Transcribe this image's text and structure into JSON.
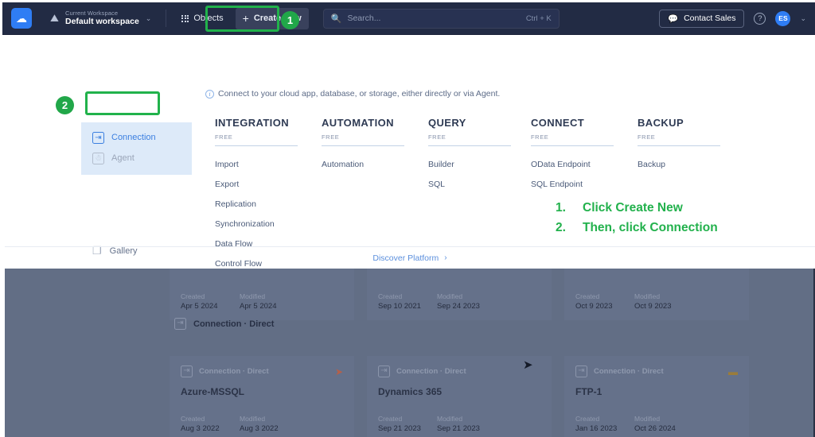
{
  "topnav": {
    "logo_icon": "cloud-icon",
    "workspace": {
      "eyebrow": "Current Workspace",
      "name": "Default workspace",
      "caret": "⌄",
      "icon": "workspace-icon"
    },
    "objects_label": "Objects",
    "create_new_label": "Create New",
    "create_new_plus": "+",
    "search": {
      "value": "",
      "placeholder": "Search...",
      "shortcut": "Ctrl + K",
      "icon": "search-icon"
    },
    "contact_sales_label": "Contact Sales",
    "contact_icon": "chat-icon",
    "help_icon": "?",
    "avatar_initials": "ES",
    "avatar_caret": "⌄"
  },
  "callouts": {
    "badge_one": "1",
    "badge_two": "2",
    "accent_green": "#21b24b",
    "tips": [
      {
        "num": "1.",
        "text": "Click Create New"
      },
      {
        "num": "2.",
        "text": "Then, click Connection"
      }
    ]
  },
  "panel": {
    "info_icon": "info-icon",
    "info_text": "Connect to your cloud app, database, or storage, either directly or via Agent.",
    "side_items": [
      {
        "label": "Connection",
        "icon": "connection-icon",
        "active": true
      },
      {
        "label": "Agent",
        "icon": "agent-icon",
        "active": false
      }
    ],
    "gallery": {
      "label": "Gallery",
      "icon": "gallery-icon"
    },
    "columns": [
      {
        "heading": "INTEGRATION",
        "tier": "FREE",
        "items": [
          "Import",
          "Export",
          "Replication",
          "Synchronization",
          "Data Flow",
          "Control Flow"
        ]
      },
      {
        "heading": "AUTOMATION",
        "tier": "FREE",
        "items": [
          "Automation"
        ]
      },
      {
        "heading": "QUERY",
        "tier": "FREE",
        "items": [
          "Builder",
          "SQL"
        ]
      },
      {
        "heading": "CONNECT",
        "tier": "FREE",
        "items": [
          "OData Endpoint",
          "SQL Endpoint"
        ]
      },
      {
        "heading": "BACKUP",
        "tier": "FREE",
        "items": [
          "Backup"
        ]
      }
    ],
    "discover": {
      "label": "Discover Platform",
      "arrow": "›"
    }
  },
  "background": {
    "overlay_color": "#626e85",
    "section_label": "Connection · Direct",
    "section_icon": "connection-icon",
    "meta_created_label": "Created",
    "meta_modified_label": "Modified",
    "cards_row_top": [
      {
        "created": "Apr 5 2024",
        "modified": "Apr 5 2024"
      },
      {
        "created": "Sep 10 2021",
        "modified": "Sep 24 2023"
      },
      {
        "created": "Oct 9 2023",
        "modified": "Oct 9 2023"
      }
    ],
    "cards_row_bottom": [
      {
        "type": "Connection · Direct",
        "title": "Azure-MSSQL",
        "created": "Aug 3 2022",
        "modified": "Aug 3 2022",
        "badge": "➤",
        "badge_color": "#b4604a"
      },
      {
        "type": "Connection · Direct",
        "title": "Dynamics 365",
        "created": "Sep 21 2023",
        "modified": "Sep 21 2023",
        "badge": "",
        "badge_color": "#626e85"
      },
      {
        "type": "Connection · Direct",
        "title": "FTP-1",
        "created": "Jan 16 2023",
        "modified": "Oct 26 2024",
        "badge": "▬",
        "badge_color": "#9b7c3a"
      }
    ],
    "cursor": "➤"
  }
}
